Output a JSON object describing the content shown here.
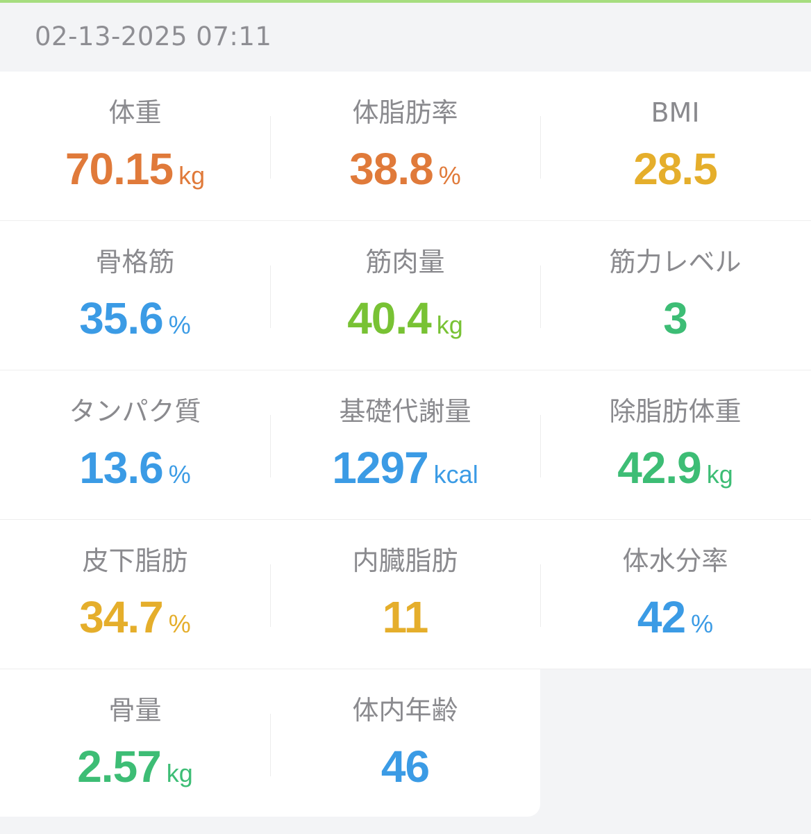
{
  "header": {
    "timestamp": "02-13-2025 07:11"
  },
  "colors": {
    "accent_bar": "#a6dd7f",
    "orange": "#e07a3a",
    "yellow": "#e5ae2b",
    "blue": "#3b9be5",
    "lime": "#78c234",
    "green": "#3dbd75"
  },
  "metrics": [
    [
      {
        "label": "体重",
        "value": "70.15",
        "unit": "kg",
        "color": "#e07a3a"
      },
      {
        "label": "体脂肪率",
        "value": "38.8",
        "unit": "%",
        "color": "#e07a3a"
      },
      {
        "label": "BMI",
        "value": "28.5",
        "unit": "",
        "color": "#e5ae2b"
      }
    ],
    [
      {
        "label": "骨格筋",
        "value": "35.6",
        "unit": "%",
        "color": "#3b9be5"
      },
      {
        "label": "筋肉量",
        "value": "40.4",
        "unit": "kg",
        "color": "#78c234"
      },
      {
        "label": "筋力レベル",
        "value": "3",
        "unit": "",
        "color": "#3dbd75"
      }
    ],
    [
      {
        "label": "タンパク質",
        "value": "13.6",
        "unit": "%",
        "color": "#3b9be5"
      },
      {
        "label": "基礎代謝量",
        "value": "1297",
        "unit": "kcal",
        "color": "#3b9be5"
      },
      {
        "label": "除脂肪体重",
        "value": "42.9",
        "unit": "kg",
        "color": "#3dbd75"
      }
    ],
    [
      {
        "label": "皮下脂肪",
        "value": "34.7",
        "unit": "%",
        "color": "#e5ae2b"
      },
      {
        "label": "内臓脂肪",
        "value": "11",
        "unit": "",
        "color": "#e5ae2b"
      },
      {
        "label": "体水分率",
        "value": "42",
        "unit": "%",
        "color": "#3b9be5"
      }
    ],
    [
      {
        "label": "骨量",
        "value": "2.57",
        "unit": "kg",
        "color": "#3dbd75"
      },
      {
        "label": "体内年齢",
        "value": "46",
        "unit": "",
        "color": "#3b9be5"
      }
    ]
  ]
}
